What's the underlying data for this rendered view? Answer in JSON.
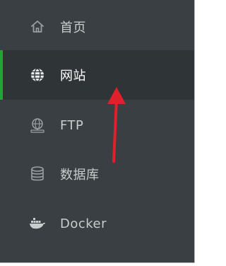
{
  "sidebar": {
    "items": [
      {
        "label": "首页",
        "icon": "home-icon",
        "active": false
      },
      {
        "label": "网站",
        "icon": "globe-icon",
        "active": true
      },
      {
        "label": "FTP",
        "icon": "ftp-icon",
        "active": false
      },
      {
        "label": "数据库",
        "icon": "database-icon",
        "active": false
      },
      {
        "label": "Docker",
        "icon": "docker-icon",
        "active": false
      }
    ]
  },
  "colors": {
    "background": "#3a3f43",
    "active_background": "#2f3437",
    "active_indicator": "#20a53a",
    "text": "#c9cccd",
    "active_text": "#ffffff",
    "annotation_arrow": "#e0202a"
  },
  "annotation": {
    "icon": "up-arrow-annotation"
  }
}
